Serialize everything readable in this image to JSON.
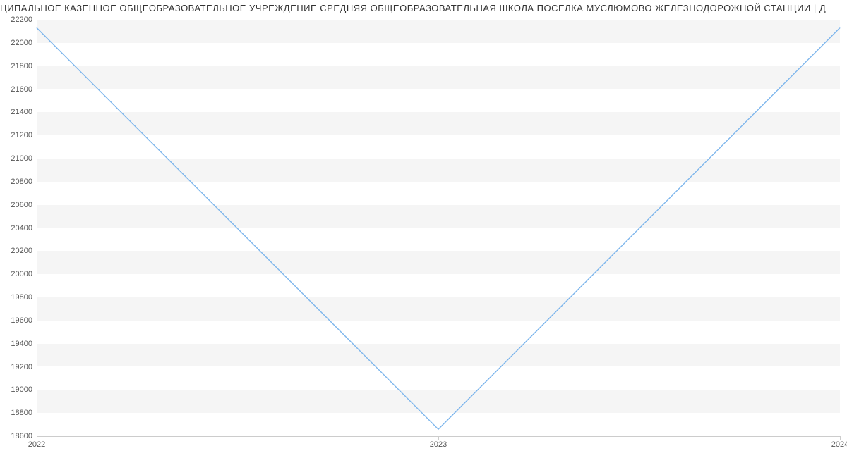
{
  "chart_data": {
    "type": "line",
    "title": "ЦИПАЛЬНОЕ КАЗЕННОЕ ОБЩЕОБРАЗОВАТЕЛЬНОЕ УЧРЕЖДЕНИЕ СРЕДНЯЯ ОБЩЕОБРАЗОВАТЕЛЬНАЯ ШКОЛА ПОСЕЛКА МУСЛЮМОВО ЖЕЛЕЗНОДОРОЖНОЙ СТАНЦИИ | Д",
    "x": [
      "2022",
      "2023",
      "2024"
    ],
    "values": [
      22130,
      18660,
      22130
    ],
    "ylim": [
      18600,
      22200
    ],
    "yticks": [
      18600,
      18800,
      19000,
      19200,
      19400,
      19600,
      19800,
      20000,
      20200,
      20400,
      20600,
      20800,
      21000,
      21200,
      21400,
      21600,
      21800,
      22000,
      22200
    ],
    "xlabel": "",
    "ylabel": "",
    "line_color": "#7cb5ec"
  }
}
